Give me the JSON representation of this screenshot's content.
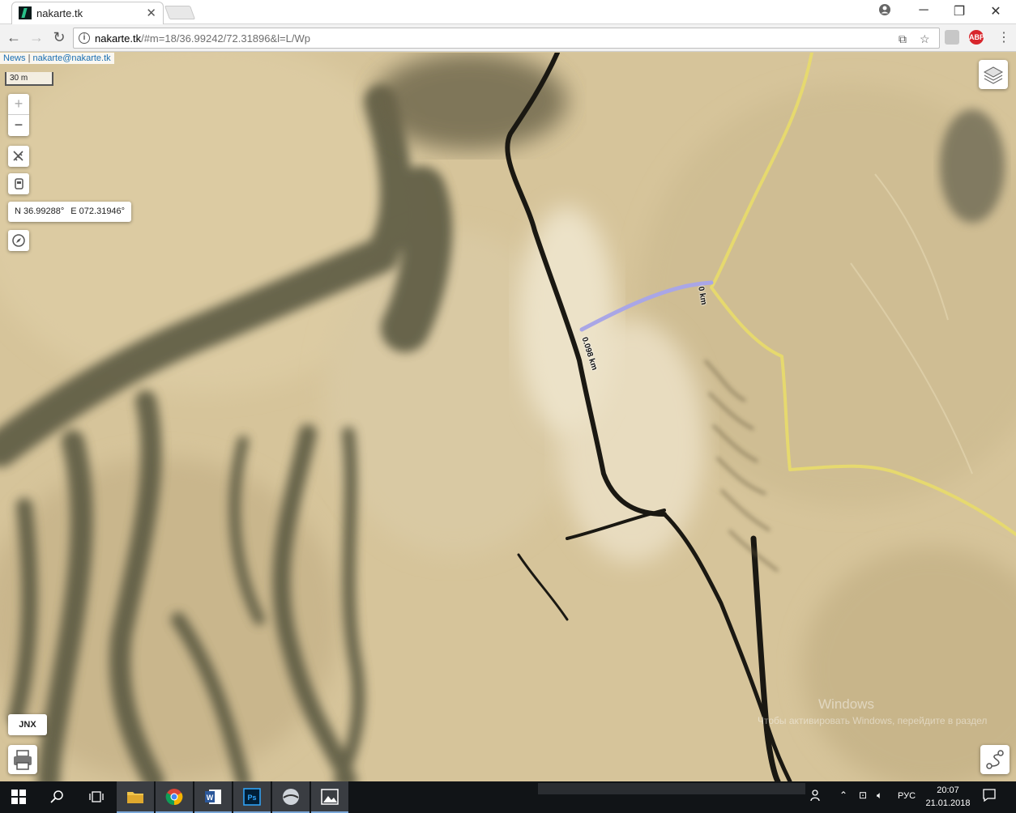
{
  "browser": {
    "tab_title": "nakarte.tk",
    "tab_close": "✕",
    "url_host": "nakarte.tk",
    "url_path": "/#m=18/36.99242/72.31896&l=L/Wp",
    "window_controls": {
      "minimize": "─",
      "restore": "❐",
      "close": "✕"
    },
    "profile_icon": "account-circle-icon",
    "extensions": [
      {
        "label": "ABP",
        "color": "#d8262c"
      }
    ]
  },
  "map": {
    "links": {
      "news": "News",
      "separator": "|",
      "email": "nakarte@nakarte.tk"
    },
    "scale_label": "30 m",
    "zoom_in": "+",
    "zoom_out": "−",
    "coords": {
      "lat": "N 36.99288°",
      "lon": "E 072.31946°"
    },
    "jnx_label": "JNX",
    "measure_labels": {
      "start": "0 km",
      "end": "0.098 km"
    },
    "track_color": "#a9a6e6",
    "trail_color": "#e8dc6a",
    "watermark_title": "Windows",
    "watermark_text": "Чтобы активировать Windows, перейдите в раздел"
  },
  "taskbar": {
    "lang": "РУС",
    "time": "20:07",
    "date": "21.01.2018"
  }
}
